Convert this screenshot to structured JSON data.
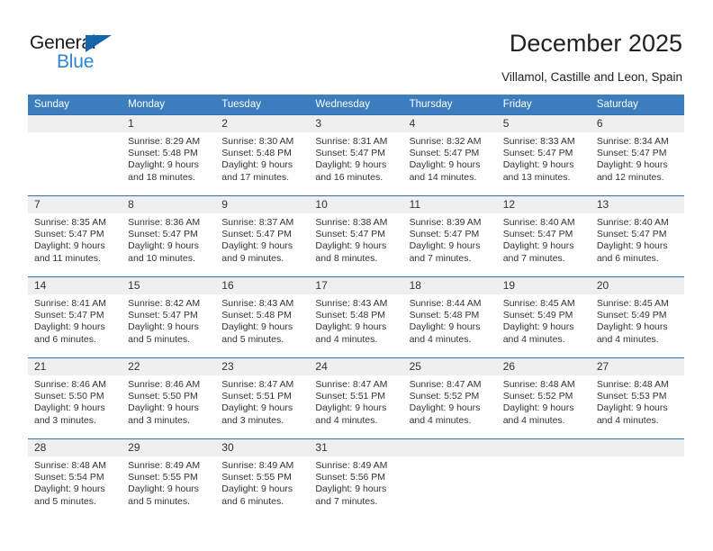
{
  "brand": {
    "name_part1": "General",
    "name_part2": "Blue",
    "accent_color": "#2b86d4",
    "triangle_color": "#1565a8"
  },
  "header": {
    "title": "December 2025",
    "subtitle": "Villamol, Castille and Leon, Spain"
  },
  "calendar": {
    "header_background": "#3b7dbd",
    "header_text_color": "#ffffff",
    "daynum_band_color": "#efefef",
    "row_border_color": "#2f6fae",
    "weekday_headers": [
      "Sunday",
      "Monday",
      "Tuesday",
      "Wednesday",
      "Thursday",
      "Friday",
      "Saturday"
    ],
    "weeks": [
      [
        {
          "day": "",
          "sunrise": "",
          "sunset": "",
          "daylight_line1": "",
          "daylight_line2": ""
        },
        {
          "day": "1",
          "sunrise": "Sunrise: 8:29 AM",
          "sunset": "Sunset: 5:48 PM",
          "daylight_line1": "Daylight: 9 hours",
          "daylight_line2": "and 18 minutes."
        },
        {
          "day": "2",
          "sunrise": "Sunrise: 8:30 AM",
          "sunset": "Sunset: 5:48 PM",
          "daylight_line1": "Daylight: 9 hours",
          "daylight_line2": "and 17 minutes."
        },
        {
          "day": "3",
          "sunrise": "Sunrise: 8:31 AM",
          "sunset": "Sunset: 5:47 PM",
          "daylight_line1": "Daylight: 9 hours",
          "daylight_line2": "and 16 minutes."
        },
        {
          "day": "4",
          "sunrise": "Sunrise: 8:32 AM",
          "sunset": "Sunset: 5:47 PM",
          "daylight_line1": "Daylight: 9 hours",
          "daylight_line2": "and 14 minutes."
        },
        {
          "day": "5",
          "sunrise": "Sunrise: 8:33 AM",
          "sunset": "Sunset: 5:47 PM",
          "daylight_line1": "Daylight: 9 hours",
          "daylight_line2": "and 13 minutes."
        },
        {
          "day": "6",
          "sunrise": "Sunrise: 8:34 AM",
          "sunset": "Sunset: 5:47 PM",
          "daylight_line1": "Daylight: 9 hours",
          "daylight_line2": "and 12 minutes."
        }
      ],
      [
        {
          "day": "7",
          "sunrise": "Sunrise: 8:35 AM",
          "sunset": "Sunset: 5:47 PM",
          "daylight_line1": "Daylight: 9 hours",
          "daylight_line2": "and 11 minutes."
        },
        {
          "day": "8",
          "sunrise": "Sunrise: 8:36 AM",
          "sunset": "Sunset: 5:47 PM",
          "daylight_line1": "Daylight: 9 hours",
          "daylight_line2": "and 10 minutes."
        },
        {
          "day": "9",
          "sunrise": "Sunrise: 8:37 AM",
          "sunset": "Sunset: 5:47 PM",
          "daylight_line1": "Daylight: 9 hours",
          "daylight_line2": "and 9 minutes."
        },
        {
          "day": "10",
          "sunrise": "Sunrise: 8:38 AM",
          "sunset": "Sunset: 5:47 PM",
          "daylight_line1": "Daylight: 9 hours",
          "daylight_line2": "and 8 minutes."
        },
        {
          "day": "11",
          "sunrise": "Sunrise: 8:39 AM",
          "sunset": "Sunset: 5:47 PM",
          "daylight_line1": "Daylight: 9 hours",
          "daylight_line2": "and 7 minutes."
        },
        {
          "day": "12",
          "sunrise": "Sunrise: 8:40 AM",
          "sunset": "Sunset: 5:47 PM",
          "daylight_line1": "Daylight: 9 hours",
          "daylight_line2": "and 7 minutes."
        },
        {
          "day": "13",
          "sunrise": "Sunrise: 8:40 AM",
          "sunset": "Sunset: 5:47 PM",
          "daylight_line1": "Daylight: 9 hours",
          "daylight_line2": "and 6 minutes."
        }
      ],
      [
        {
          "day": "14",
          "sunrise": "Sunrise: 8:41 AM",
          "sunset": "Sunset: 5:47 PM",
          "daylight_line1": "Daylight: 9 hours",
          "daylight_line2": "and 6 minutes."
        },
        {
          "day": "15",
          "sunrise": "Sunrise: 8:42 AM",
          "sunset": "Sunset: 5:47 PM",
          "daylight_line1": "Daylight: 9 hours",
          "daylight_line2": "and 5 minutes."
        },
        {
          "day": "16",
          "sunrise": "Sunrise: 8:43 AM",
          "sunset": "Sunset: 5:48 PM",
          "daylight_line1": "Daylight: 9 hours",
          "daylight_line2": "and 5 minutes."
        },
        {
          "day": "17",
          "sunrise": "Sunrise: 8:43 AM",
          "sunset": "Sunset: 5:48 PM",
          "daylight_line1": "Daylight: 9 hours",
          "daylight_line2": "and 4 minutes."
        },
        {
          "day": "18",
          "sunrise": "Sunrise: 8:44 AM",
          "sunset": "Sunset: 5:48 PM",
          "daylight_line1": "Daylight: 9 hours",
          "daylight_line2": "and 4 minutes."
        },
        {
          "day": "19",
          "sunrise": "Sunrise: 8:45 AM",
          "sunset": "Sunset: 5:49 PM",
          "daylight_line1": "Daylight: 9 hours",
          "daylight_line2": "and 4 minutes."
        },
        {
          "day": "20",
          "sunrise": "Sunrise: 8:45 AM",
          "sunset": "Sunset: 5:49 PM",
          "daylight_line1": "Daylight: 9 hours",
          "daylight_line2": "and 4 minutes."
        }
      ],
      [
        {
          "day": "21",
          "sunrise": "Sunrise: 8:46 AM",
          "sunset": "Sunset: 5:50 PM",
          "daylight_line1": "Daylight: 9 hours",
          "daylight_line2": "and 3 minutes."
        },
        {
          "day": "22",
          "sunrise": "Sunrise: 8:46 AM",
          "sunset": "Sunset: 5:50 PM",
          "daylight_line1": "Daylight: 9 hours",
          "daylight_line2": "and 3 minutes."
        },
        {
          "day": "23",
          "sunrise": "Sunrise: 8:47 AM",
          "sunset": "Sunset: 5:51 PM",
          "daylight_line1": "Daylight: 9 hours",
          "daylight_line2": "and 3 minutes."
        },
        {
          "day": "24",
          "sunrise": "Sunrise: 8:47 AM",
          "sunset": "Sunset: 5:51 PM",
          "daylight_line1": "Daylight: 9 hours",
          "daylight_line2": "and 4 minutes."
        },
        {
          "day": "25",
          "sunrise": "Sunrise: 8:47 AM",
          "sunset": "Sunset: 5:52 PM",
          "daylight_line1": "Daylight: 9 hours",
          "daylight_line2": "and 4 minutes."
        },
        {
          "day": "26",
          "sunrise": "Sunrise: 8:48 AM",
          "sunset": "Sunset: 5:52 PM",
          "daylight_line1": "Daylight: 9 hours",
          "daylight_line2": "and 4 minutes."
        },
        {
          "day": "27",
          "sunrise": "Sunrise: 8:48 AM",
          "sunset": "Sunset: 5:53 PM",
          "daylight_line1": "Daylight: 9 hours",
          "daylight_line2": "and 4 minutes."
        }
      ],
      [
        {
          "day": "28",
          "sunrise": "Sunrise: 8:48 AM",
          "sunset": "Sunset: 5:54 PM",
          "daylight_line1": "Daylight: 9 hours",
          "daylight_line2": "and 5 minutes."
        },
        {
          "day": "29",
          "sunrise": "Sunrise: 8:49 AM",
          "sunset": "Sunset: 5:55 PM",
          "daylight_line1": "Daylight: 9 hours",
          "daylight_line2": "and 5 minutes."
        },
        {
          "day": "30",
          "sunrise": "Sunrise: 8:49 AM",
          "sunset": "Sunset: 5:55 PM",
          "daylight_line1": "Daylight: 9 hours",
          "daylight_line2": "and 6 minutes."
        },
        {
          "day": "31",
          "sunrise": "Sunrise: 8:49 AM",
          "sunset": "Sunset: 5:56 PM",
          "daylight_line1": "Daylight: 9 hours",
          "daylight_line2": "and 7 minutes."
        },
        {
          "day": "",
          "sunrise": "",
          "sunset": "",
          "daylight_line1": "",
          "daylight_line2": ""
        },
        {
          "day": "",
          "sunrise": "",
          "sunset": "",
          "daylight_line1": "",
          "daylight_line2": ""
        },
        {
          "day": "",
          "sunrise": "",
          "sunset": "",
          "daylight_line1": "",
          "daylight_line2": ""
        }
      ]
    ]
  }
}
